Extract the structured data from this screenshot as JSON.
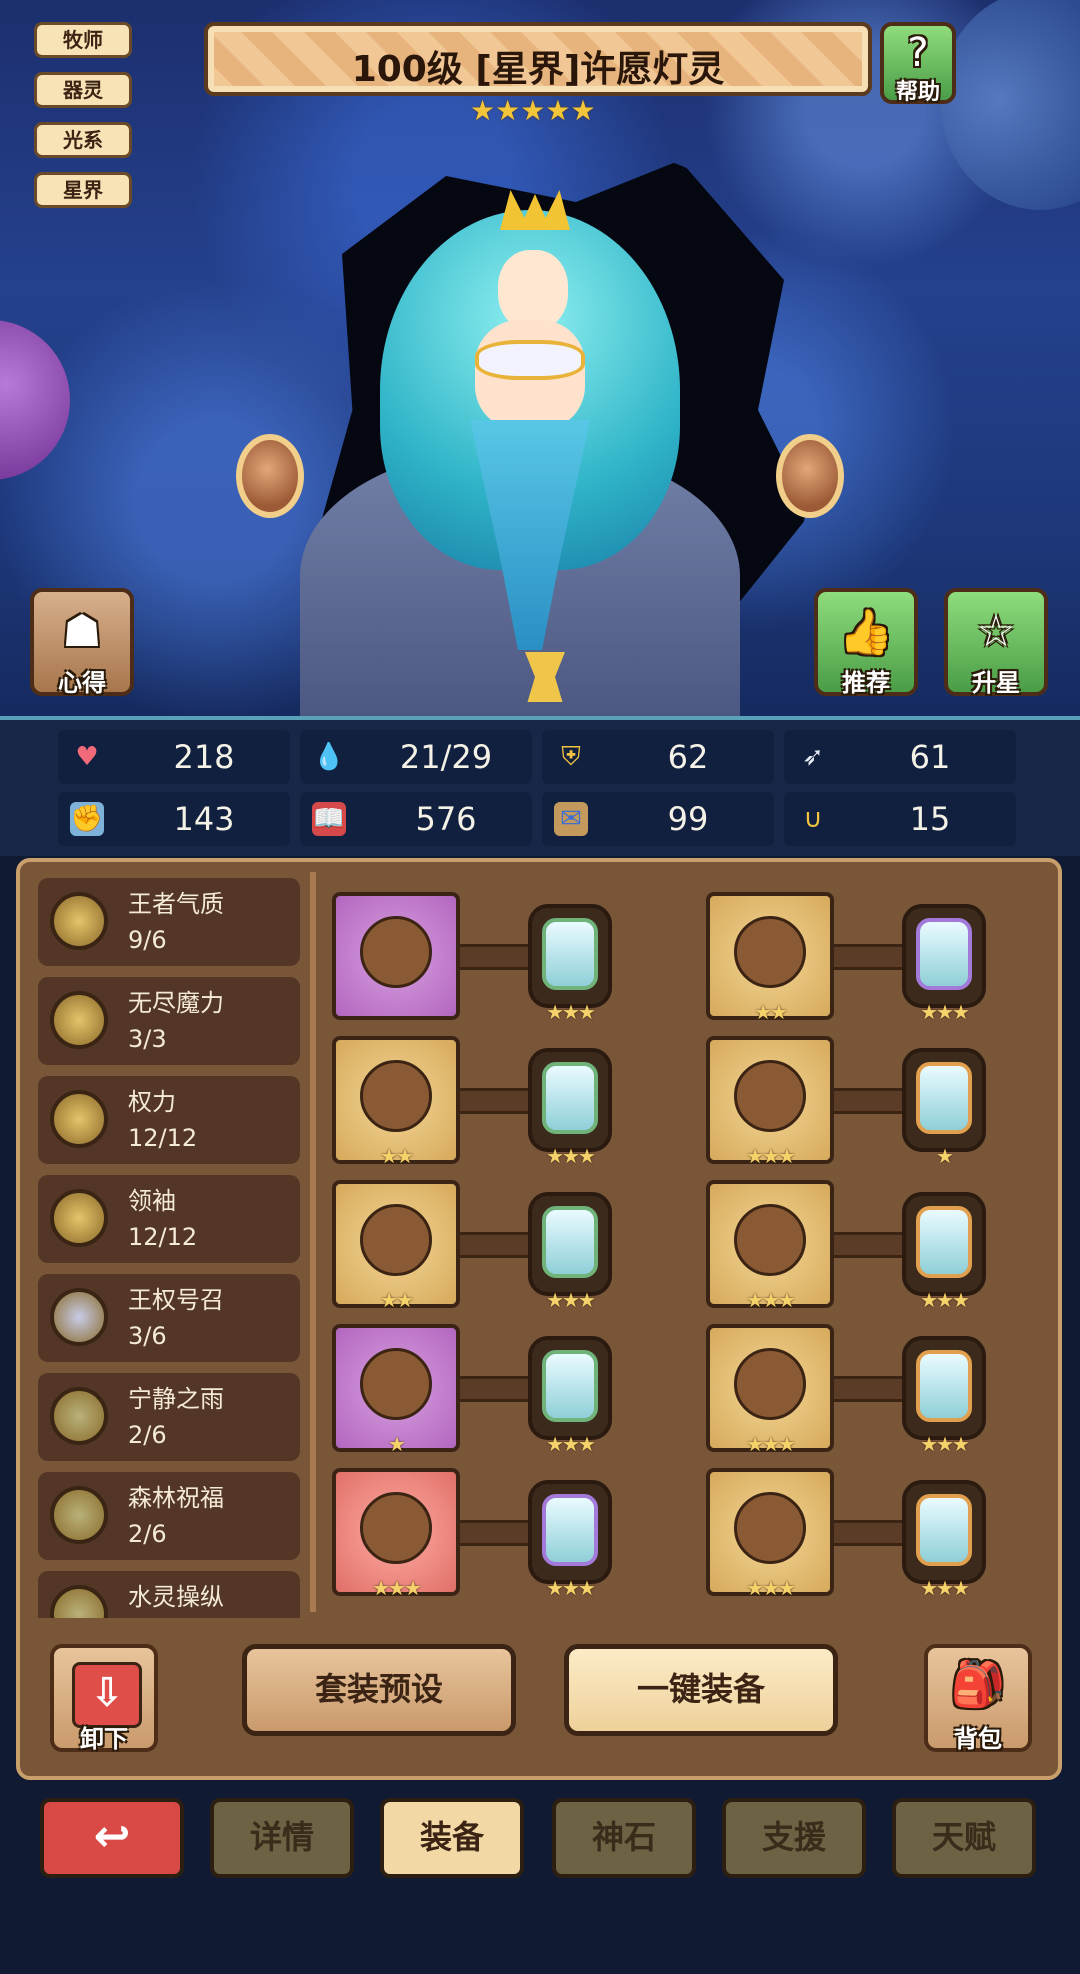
{
  "tags": [
    "牧师",
    "器灵",
    "光系",
    "星界"
  ],
  "title": "100级  [星界]许愿灯灵",
  "star_rating": 5,
  "buttons": {
    "help": "帮助",
    "insight": "心得",
    "recommend": "推荐",
    "star_up": "升星"
  },
  "stats": [
    {
      "icon": "heart-icon",
      "value": "218"
    },
    {
      "icon": "water-drop-icon",
      "value": "21/29"
    },
    {
      "icon": "shield-icon",
      "value": "62"
    },
    {
      "icon": "wing-icon",
      "value": "61"
    },
    {
      "icon": "fist-icon",
      "value": "143"
    },
    {
      "icon": "spellbook-icon",
      "value": "576"
    },
    {
      "icon": "scroll-icon",
      "value": "99"
    },
    {
      "icon": "horseshoe-icon",
      "value": "15"
    }
  ],
  "traits": [
    {
      "name": "王者气质",
      "count": "9/6",
      "coin": "#e6c46a"
    },
    {
      "name": "无尽魔力",
      "count": "3/3",
      "coin": "#e6c46a"
    },
    {
      "name": "权力",
      "count": "12/12",
      "coin": "#e6c46a"
    },
    {
      "name": "领袖",
      "count": "12/12",
      "coin": "#e6c46a"
    },
    {
      "name": "王权号召",
      "count": "3/6",
      "coin": "#c7cce8"
    },
    {
      "name": "宁静之雨",
      "count": "2/6",
      "coin": "#b9b27a"
    },
    {
      "name": "森林祝福",
      "count": "2/6",
      "coin": "#b9b27a"
    },
    {
      "name": "水灵操纵",
      "count": "",
      "coin": "#b9b27a"
    }
  ],
  "equipment": [
    {
      "item": "scepter",
      "bg": "purple",
      "item_stars": 0,
      "gem_border": "green",
      "gem_stars": 3
    },
    {
      "item": "crystal-hat",
      "bg": "gold",
      "item_stars": 2,
      "gem_border": "purple",
      "gem_stars": 3
    },
    {
      "item": "orb",
      "bg": "gold",
      "item_stars": 2,
      "gem_border": "green",
      "gem_stars": 3
    },
    {
      "item": "robe",
      "bg": "gold",
      "item_stars": 3,
      "gem_border": "orange",
      "gem_stars": 1
    },
    {
      "item": "necklace",
      "bg": "gold",
      "item_stars": 2,
      "gem_border": "green",
      "gem_stars": 3
    },
    {
      "item": "gloves",
      "bg": "gold",
      "item_stars": 3,
      "gem_border": "orange",
      "gem_stars": 3
    },
    {
      "item": "spiked-orb",
      "bg": "purple",
      "item_stars": 1,
      "gem_border": "green",
      "gem_stars": 3
    },
    {
      "item": "belt",
      "bg": "gold",
      "item_stars": 3,
      "gem_border": "orange",
      "gem_stars": 3
    },
    {
      "item": "ring",
      "bg": "pink",
      "item_stars": 3,
      "gem_border": "purple",
      "gem_stars": 3
    },
    {
      "item": "boots",
      "bg": "gold",
      "item_stars": 3,
      "gem_border": "orange",
      "gem_stars": 3
    }
  ],
  "panel_buttons": {
    "unequip": "卸下",
    "set_preset": "套装预设",
    "one_click_equip": "一键装备",
    "backpack": "背包"
  },
  "tabs": [
    "详情",
    "装备",
    "神石",
    "支援",
    "天赋"
  ],
  "active_tab": "装备"
}
